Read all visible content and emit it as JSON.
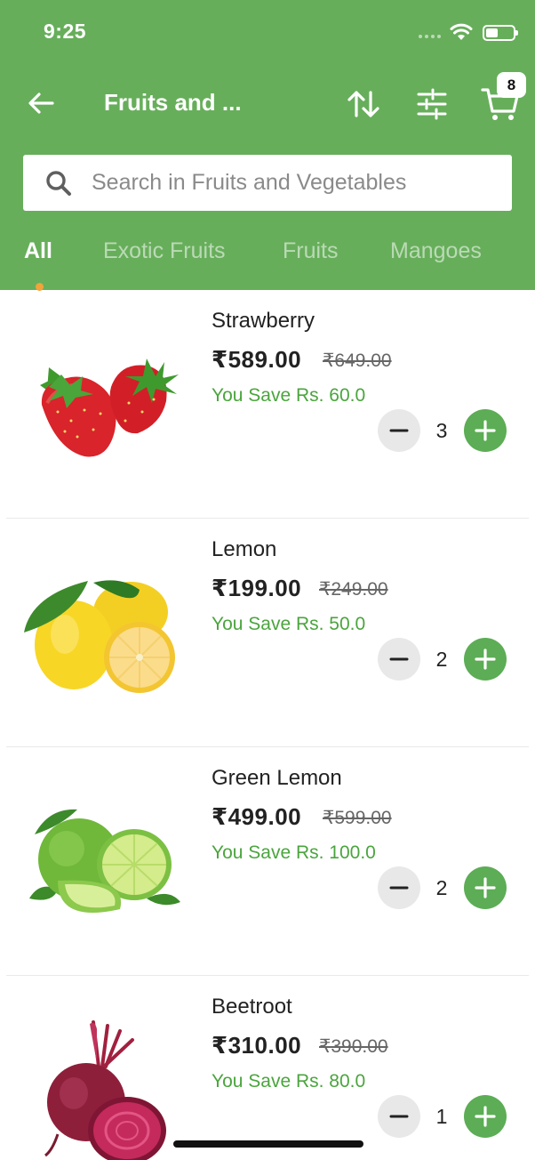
{
  "status_bar": {
    "time": "9:25"
  },
  "header": {
    "title": "Fruits and ...",
    "cart_count": "8",
    "accent_color": "#67ae5b"
  },
  "search": {
    "placeholder": "Search in Fruits and Vegetables"
  },
  "tabs": [
    {
      "label": "All",
      "active": true
    },
    {
      "label": "Exotic Fruits",
      "active": false
    },
    {
      "label": "Fruits",
      "active": false
    },
    {
      "label": "Mangoes",
      "active": false
    }
  ],
  "products": [
    {
      "name": "Strawberry",
      "price": "₹589.00",
      "old_price": "₹649.00",
      "save_text": "You Save Rs. 60.0",
      "quantity": "3",
      "image": "strawberry-image"
    },
    {
      "name": "Lemon",
      "price": "₹199.00",
      "old_price": "₹249.00",
      "save_text": "You Save Rs. 50.0",
      "quantity": "2",
      "image": "lemon-image"
    },
    {
      "name": "Green Lemon",
      "price": "₹499.00",
      "old_price": "₹599.00",
      "save_text": "You Save Rs. 100.0",
      "quantity": "2",
      "image": "green-lemon-image"
    },
    {
      "name": "Beetroot",
      "price": "₹310.00",
      "old_price": "₹390.00",
      "save_text": "You Save Rs. 80.0",
      "quantity": "1",
      "image": "beetroot-image"
    }
  ]
}
